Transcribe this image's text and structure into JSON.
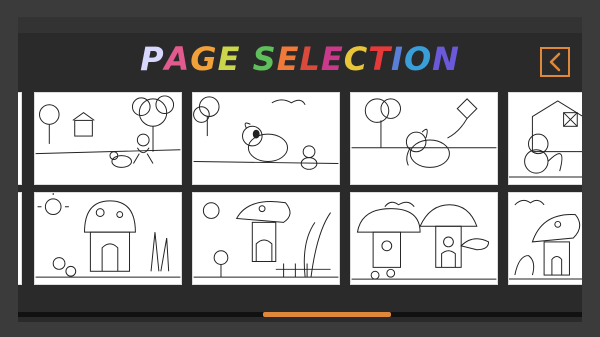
{
  "header": {
    "title_letters": [
      "P",
      "A",
      "G",
      "E",
      " ",
      "S",
      "E",
      "L",
      "E",
      "C",
      "T",
      "I",
      "O",
      "N"
    ],
    "title_colors": [
      "#d8d8ff",
      "#e25b8e",
      "#f0a13a",
      "#cbd64a",
      " ",
      "#5fbf5a",
      "#f07a3a",
      "#d94a3a",
      "#c93a8a",
      "#e7c43a",
      "#e53a3a",
      "#5a7fd9",
      "#3a9fd9",
      "#6a5ad9"
    ],
    "back_icon": "chevron-left-icon"
  },
  "colors": {
    "accent": "#e0883a"
  },
  "pages": [
    {
      "scene": "boy-park"
    },
    {
      "scene": "puppy-duck"
    },
    {
      "scene": "elephant-kite"
    },
    {
      "scene": "squirrel-barn"
    },
    {
      "scene": "mushroom-house"
    },
    {
      "scene": "mushroom-garden"
    },
    {
      "scene": "mushroom-village"
    },
    {
      "scene": "mushroom-meadow"
    }
  ],
  "scroll": {
    "position_fraction": 0.44
  }
}
